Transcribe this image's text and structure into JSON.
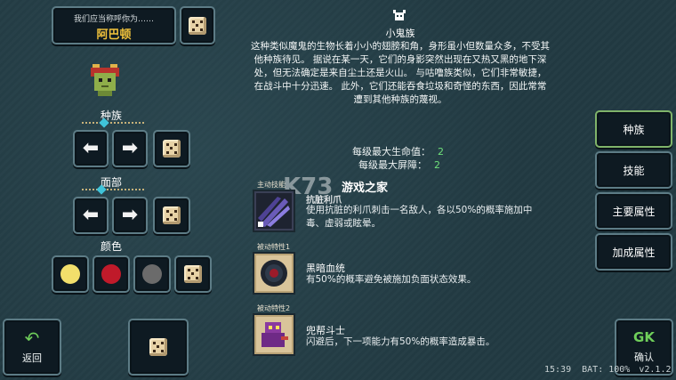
{
  "name_panel": {
    "prompt": "我们应当称呼你为……",
    "name": "阿巴顿"
  },
  "race": {
    "label": "种族",
    "title": "小鬼族",
    "description": [
      "这种类似魔鬼的生物长着小小的翅膀和角，身形虽小但数量众多，不受其",
      "他种族待见。 据说在某一天，它们的身影突然出现在又热又黑的地下深",
      "处，但无法确定是来自尘土还是火山。 与咕噜族类似，它们非常敏捷，",
      "在战斗中十分迅速。 此外，它们还能吞食垃圾和奇怪的东西，因此常常",
      "遭到其他种族的蔑视。"
    ]
  },
  "face": {
    "label": "面部"
  },
  "color": {
    "label": "颜色",
    "swatches": [
      "#f2df6b",
      "#c01a2a",
      "#6b6b6b"
    ]
  },
  "stats": [
    {
      "label": "每级最大生命值：",
      "value": "2"
    },
    {
      "label": "每级最大屏障：",
      "value": "2"
    }
  ],
  "abilities": [
    {
      "tag": "主动技能",
      "name": "抗脏利爪",
      "desc": [
        "使用抗脏的利爪刺击一名敌人，各以50%的概率施加中",
        "毒、虚弱或眩晕。"
      ],
      "icon": "claw-icon"
    },
    {
      "tag": "被动特性1",
      "name": "黑暗血统",
      "desc": [
        "有50%的概率避免被施加负面状态效果。"
      ],
      "icon": "dark-orb-icon"
    },
    {
      "tag": "被动特性2",
      "name": "兜帮斗士",
      "desc": [
        "闪避后，下一项能力有50%的概率造成暴击。"
      ],
      "icon": "imp-fighter-icon"
    }
  ],
  "tabs": [
    {
      "label": "种族",
      "active": true
    },
    {
      "label": "技能",
      "active": false
    },
    {
      "label": "主要属性",
      "active": false
    },
    {
      "label": "加成属性",
      "active": false
    }
  ],
  "watermark": {
    "title": "游戏之家",
    "logo": "K73"
  },
  "bottom": {
    "back_label": "返回",
    "confirm_label": "确认",
    "confirm_mark": "GK"
  },
  "status_bar": {
    "time": "15:39",
    "battery": "BAT: 100%",
    "version": "v2.1.2"
  }
}
